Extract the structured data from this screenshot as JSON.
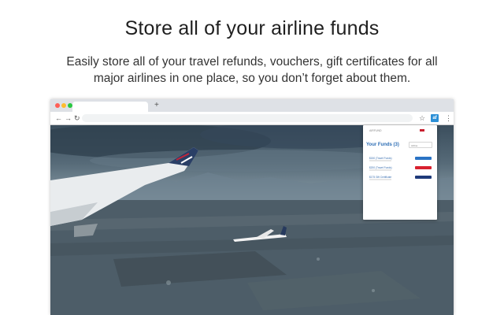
{
  "headline": "Store all of your airline funds",
  "subheadline": "Easily store all of your travel refunds, vouchers, gift certificates for all major airlines in one place, so you don’t forget about them.",
  "browser": {
    "new_tab_glyph": "+",
    "back_glyph": "←",
    "forward_glyph": "→",
    "reload_glyph": "↻",
    "star_glyph": "☆",
    "menu_glyph": "⋮",
    "extension_icon": "airline-funds-extension-icon",
    "extension_badge": "af",
    "window_dot_colors": [
      "#ff5f57",
      "#febc2e",
      "#28c840"
    ]
  },
  "popup": {
    "brand": "AIRFUND",
    "title": "Your Funds (3)",
    "filter_value": "Airline",
    "funds": [
      {
        "label": "$150 (Travel Funds)",
        "badge_color": "#2a73c5"
      },
      {
        "label": "$200 (Travel Funds)",
        "badge_color": "#d8212f"
      },
      {
        "label": "$175 Gift Certificate",
        "badge_color": "#1f3a7a"
      }
    ]
  }
}
